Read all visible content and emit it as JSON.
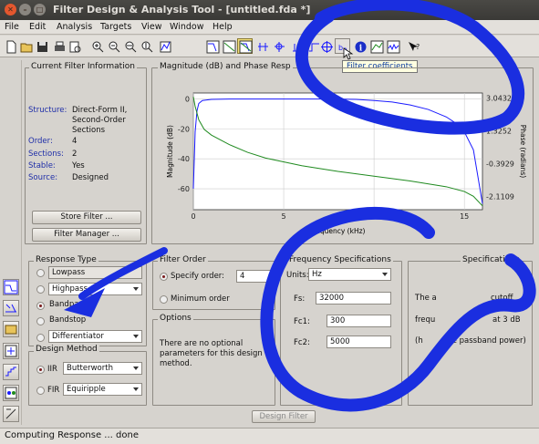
{
  "window": {
    "title": "Filter Design & Analysis Tool -  [untitled.fda *]"
  },
  "menu": [
    "File",
    "Edit",
    "Analysis",
    "Targets",
    "View",
    "Window",
    "Help"
  ],
  "toolbar": {
    "icons": [
      "new-icon",
      "open-icon",
      "save-icon",
      "print-icon",
      "print-preview-icon",
      "zoom-in-icon",
      "zoom-out-icon",
      "zoom-x-icon",
      "zoom-y-icon",
      "full-view-icon",
      "magnitude-response-icon",
      "phase-response-icon",
      "magnitude-phase-icon",
      "group-delay-icon",
      "phase-delay-icon",
      "impulse-response-icon",
      "step-response-icon",
      "pole-zero-icon",
      "filter-coefficients-icon",
      "filter-info-icon",
      "magnitude-estimate-icon",
      "roundoff-noise-icon",
      "whats-this-icon"
    ],
    "tooltip": "Filter coefficients"
  },
  "current_filter": {
    "legend": "Current Filter Information",
    "rows": [
      {
        "label": "Structure:",
        "value": "Direct-Form II, Second-Order Sections"
      },
      {
        "label": "Order:",
        "value": "4"
      },
      {
        "label": "Sections:",
        "value": "2"
      },
      {
        "label": "Stable:",
        "value": "Yes"
      },
      {
        "label": "Source:",
        "value": "Designed"
      }
    ],
    "store_button": "Store Filter ...",
    "manager_button": "Filter Manager ..."
  },
  "plot": {
    "legend": "Magnitude (dB) and Phase Resp",
    "left_ylabel": "Magnitude (dB)",
    "right_ylabel": "Phase (radians)",
    "xlabel": "Frequency (kHz)",
    "left_ticks": [
      "0",
      "-20",
      "-40",
      "-60"
    ],
    "right_ticks": [
      "3.0432",
      "1.3252",
      "-0.3929",
      "-2.1109"
    ],
    "x_ticks": [
      "0",
      "5",
      "10",
      "15"
    ],
    "colors": {
      "magnitude": "#1a1aff",
      "phase": "#1f8a1f"
    }
  },
  "chart_data": {
    "type": "line",
    "xlabel": "Frequency (kHz)",
    "ylabel": "Magnitude (dB)",
    "y2label": "Phase (radians)",
    "xlim": [
      0,
      16
    ],
    "ylim": [
      -74,
      4
    ],
    "y2lim": [
      -2.8,
      3.3
    ],
    "series": [
      {
        "axis": "left",
        "x": [
          0,
          0.1,
          0.2,
          0.3,
          0.5,
          1,
          2,
          4,
          6,
          8,
          9,
          10,
          11,
          12,
          13,
          14,
          14.5,
          15,
          15.5,
          16
        ],
        "y": [
          -60,
          -22,
          -8,
          -3,
          -1,
          -0.3,
          0,
          0,
          0,
          0,
          -0.3,
          -1,
          -2,
          -4,
          -7,
          -12,
          -16,
          -22,
          -34,
          -70
        ]
      },
      {
        "axis": "right",
        "x": [
          0,
          0.1,
          0.3,
          0.6,
          1,
          1.5,
          2,
          3,
          4,
          6,
          8,
          10,
          12,
          14,
          15,
          15.5,
          16
        ],
        "y": [
          3.1,
          2.6,
          1.9,
          1.4,
          1.1,
          0.85,
          0.6,
          0.2,
          -0.1,
          -0.5,
          -0.8,
          -1.05,
          -1.3,
          -1.6,
          -1.85,
          -2.1,
          -2.6
        ]
      }
    ]
  },
  "response_type": {
    "legend": "Response Type",
    "options": [
      {
        "label": "Lowpass",
        "selected": false
      },
      {
        "label": "Highpass",
        "selected": false
      },
      {
        "label": "Bandpass",
        "selected": true
      },
      {
        "label": "Bandstop",
        "selected": false
      },
      {
        "label": "Differentiator",
        "selected": false
      }
    ]
  },
  "design_method": {
    "legend": "Design Method",
    "iir_label": "IIR",
    "iir_value": "Butterworth",
    "fir_label": "FIR",
    "fir_value": "Equiripple"
  },
  "filter_order": {
    "legend": "Filter Order",
    "specify_label": "Specify order:",
    "specify_value": "4",
    "minimum_label": "Minimum order"
  },
  "options": {
    "legend": "Options",
    "text": "There are no optional parameters for this design method."
  },
  "freq_spec": {
    "legend": "Frequency Specifications",
    "units_label": "Units:",
    "units_value": "Hz",
    "fs_label": "Fs:",
    "fs_value": "32000",
    "fc1_label": "Fc1:",
    "fc1_value": "300",
    "fc2_label": "Fc2:",
    "fc2_value": "5000"
  },
  "mag_spec": {
    "legend": "Specifications",
    "text_a": "The a",
    "text_b": "cutoff",
    "text_c": "frequ",
    "text_d": "at 3 dB",
    "text_e": "(h",
    "text_f": "the passband power)"
  },
  "design_button": "Design Filter",
  "status": "Computing Response ... done"
}
